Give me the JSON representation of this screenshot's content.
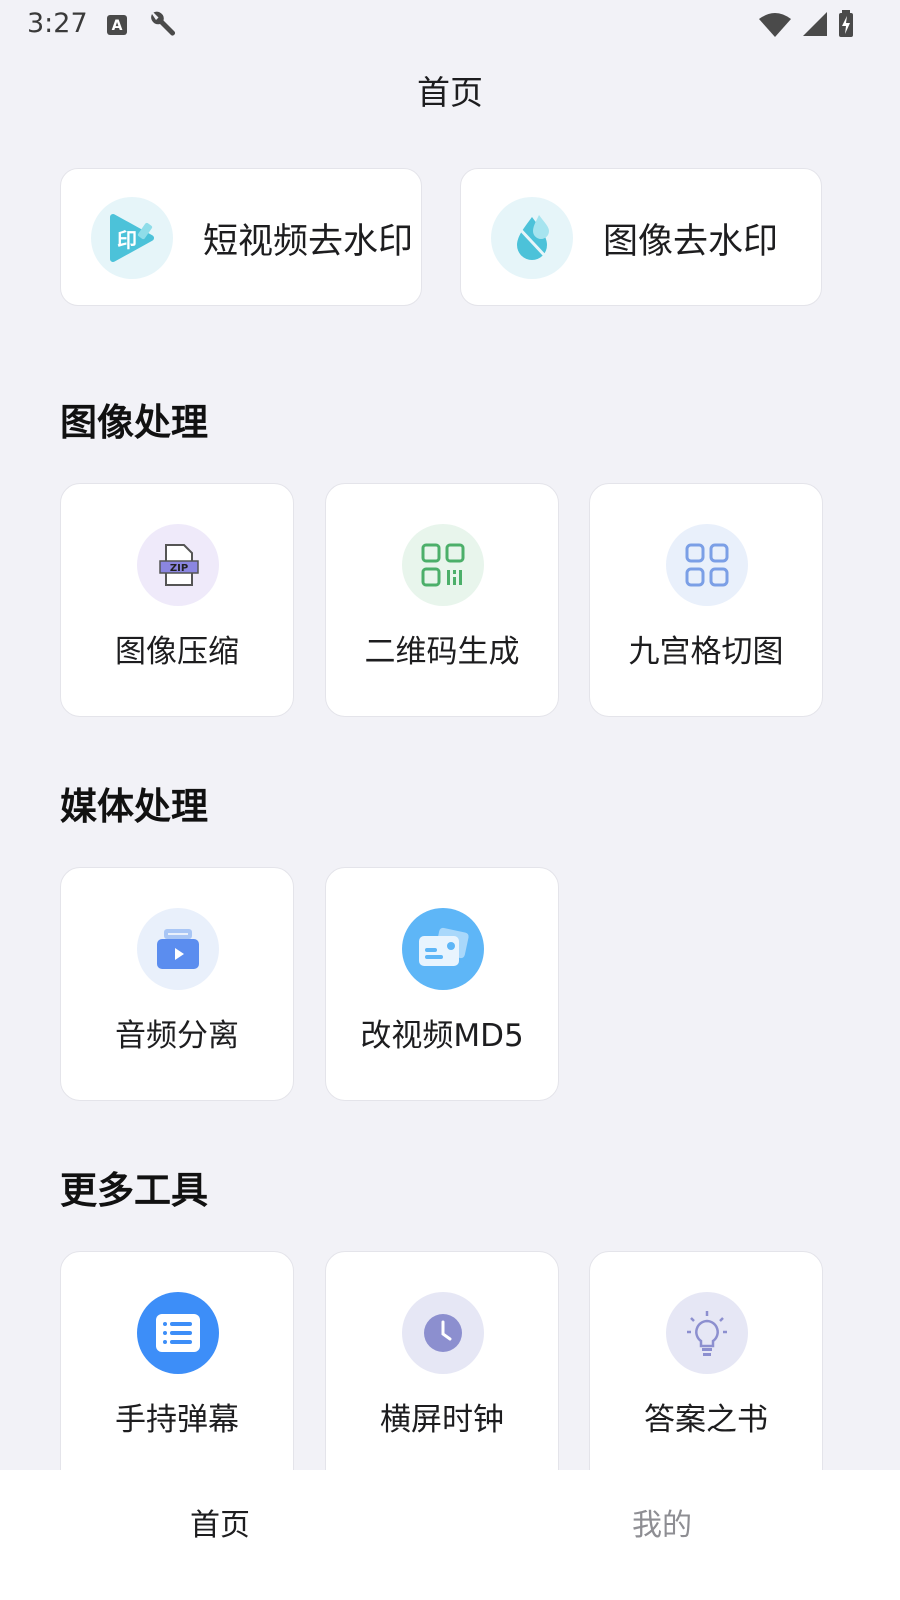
{
  "status": {
    "time": "3:27",
    "left_icons": [
      "font-icon",
      "wrench-icon"
    ],
    "right_icons": [
      "wifi-icon",
      "signal-icon",
      "battery-charging-icon"
    ]
  },
  "header": {
    "title": "首页"
  },
  "featured": [
    {
      "label": "短视频去水印",
      "icon": "video-stamp-icon"
    },
    {
      "label": "图像去水印",
      "icon": "water-drop-icon"
    }
  ],
  "sections": {
    "image": {
      "title": "图像处理",
      "items": [
        {
          "label": "图像压缩",
          "icon": "zip-file-icon"
        },
        {
          "label": "二维码生成",
          "icon": "qr-code-icon"
        },
        {
          "label": "九宫格切图",
          "icon": "grid-icon"
        }
      ]
    },
    "media": {
      "title": "媒体处理",
      "items": [
        {
          "label": "音频分离",
          "icon": "audio-video-icon"
        },
        {
          "label": "改视频MD5",
          "icon": "video-card-icon"
        }
      ]
    },
    "more": {
      "title": "更多工具",
      "items": [
        {
          "label": "手持弹幕",
          "icon": "list-icon"
        },
        {
          "label": "横屏时钟",
          "icon": "clock-icon"
        },
        {
          "label": "答案之书",
          "icon": "lightbulb-icon"
        }
      ]
    }
  },
  "nav": {
    "home": "首页",
    "me": "我的"
  },
  "colors": {
    "background": "#f2f2f7",
    "card": "#ffffff",
    "teal": "#4cc2d9",
    "green": "#4caf6a",
    "blue": "#3d8ef8",
    "lavender": "#8c8fcf"
  }
}
